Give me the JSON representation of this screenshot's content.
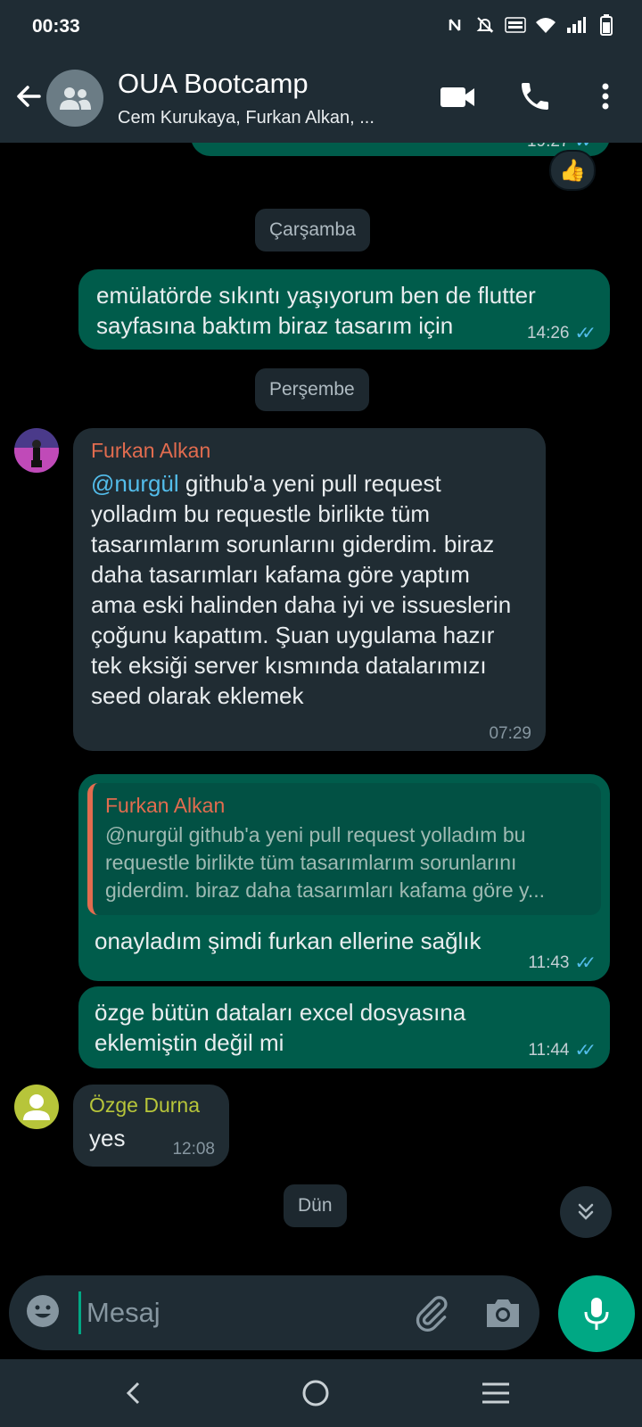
{
  "status_bar": {
    "time": "00:33"
  },
  "header": {
    "title": "OUA Bootcamp",
    "subtitle": "Cem Kurukaya, Furkan Alkan, ..."
  },
  "chat": {
    "top_partial": {
      "time": "19:27",
      "reaction": "👍"
    },
    "date_1": "Çarşamba",
    "msg_1": {
      "text": "emülatörde sıkıntı yaşıyorum ben de flutter sayfasına baktım biraz tasarım için",
      "time": "14:26"
    },
    "date_2": "Perşembe",
    "msg_2": {
      "sender": "Furkan Alkan",
      "mention": "@nurgül",
      "text": " github'a yeni pull request yolladım bu requestle birlikte tüm tasarımlarım sorunlarını giderdim. biraz daha tasarımları kafama göre yaptım ama eski halinden daha iyi ve issueslerin çoğunu kapattım. Şuan uygulama hazır tek eksiği server kısmında datalarımızı seed olarak eklemek",
      "time": "07:29"
    },
    "msg_3": {
      "quote_sender": "Furkan Alkan",
      "quote_text": "@nurgül github'a yeni pull request yolladım bu requestle birlikte tüm tasarımlarım sorunlarını giderdim. biraz daha tasarımları kafama göre y...",
      "text": "onayladım şimdi furkan ellerine sağlık",
      "time": "11:43"
    },
    "msg_4": {
      "text": "özge bütün dataları excel dosyasına eklemiştin değil mi",
      "time": "11:44"
    },
    "msg_5": {
      "sender": "Özge Durna",
      "text": "yes",
      "time": "12:08"
    },
    "date_3": "Dün"
  },
  "input": {
    "placeholder": "Mesaj"
  },
  "colors": {
    "outgoing_bubble": "#005c4b",
    "incoming_bubble": "#202c33",
    "accent": "#00a884",
    "sender_furkan": "#e26c4f",
    "sender_ozge": "#b7c53a",
    "ticks": "#53bdeb"
  }
}
